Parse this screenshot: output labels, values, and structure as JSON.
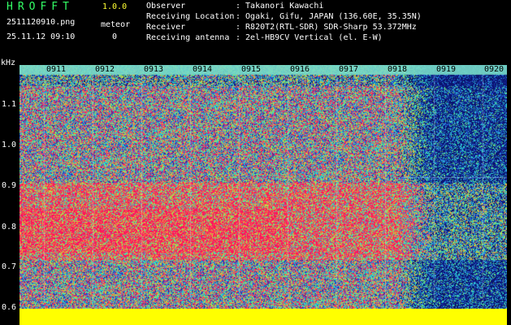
{
  "app": {
    "name": "HROFFT",
    "version": "1.0.0",
    "filename": "2511120910.png",
    "mode": "meteor",
    "datetime": "25.11.12 09:10",
    "count": "0"
  },
  "info": [
    {
      "label": "Observer",
      "value": ": Takanori Kawachi"
    },
    {
      "label": "Receiving Location",
      "value": ": Ogaki, Gifu, JAPAN (136.60E, 35.35N)"
    },
    {
      "label": "Receiver",
      "value": ": R820T2(RTL-SDR) SDR-Sharp 53.372MHz"
    },
    {
      "label": "Receiving antenna",
      "value": ": 2el-HB9CV Vertical (el. E-W)"
    }
  ],
  "spectrogram": {
    "y_unit": "kHz",
    "y_ticks": [
      "1.1",
      "1.0",
      "0.9",
      "0.8",
      "0.7",
      "0.6"
    ],
    "x_ticks": [
      "0911",
      "0912",
      "0913",
      "0914",
      "0915",
      "0916",
      "0917",
      "0918",
      "0919",
      "0920"
    ]
  },
  "colors": {
    "text_green": "#33ff66",
    "text_white": "#ffffff",
    "text_yellow": "#ffff33",
    "noise_low": "#1a2a8c",
    "noise_mid": "#2ee6c8",
    "noise_high": "#ff1a66",
    "baseline": "#ffff00"
  }
}
